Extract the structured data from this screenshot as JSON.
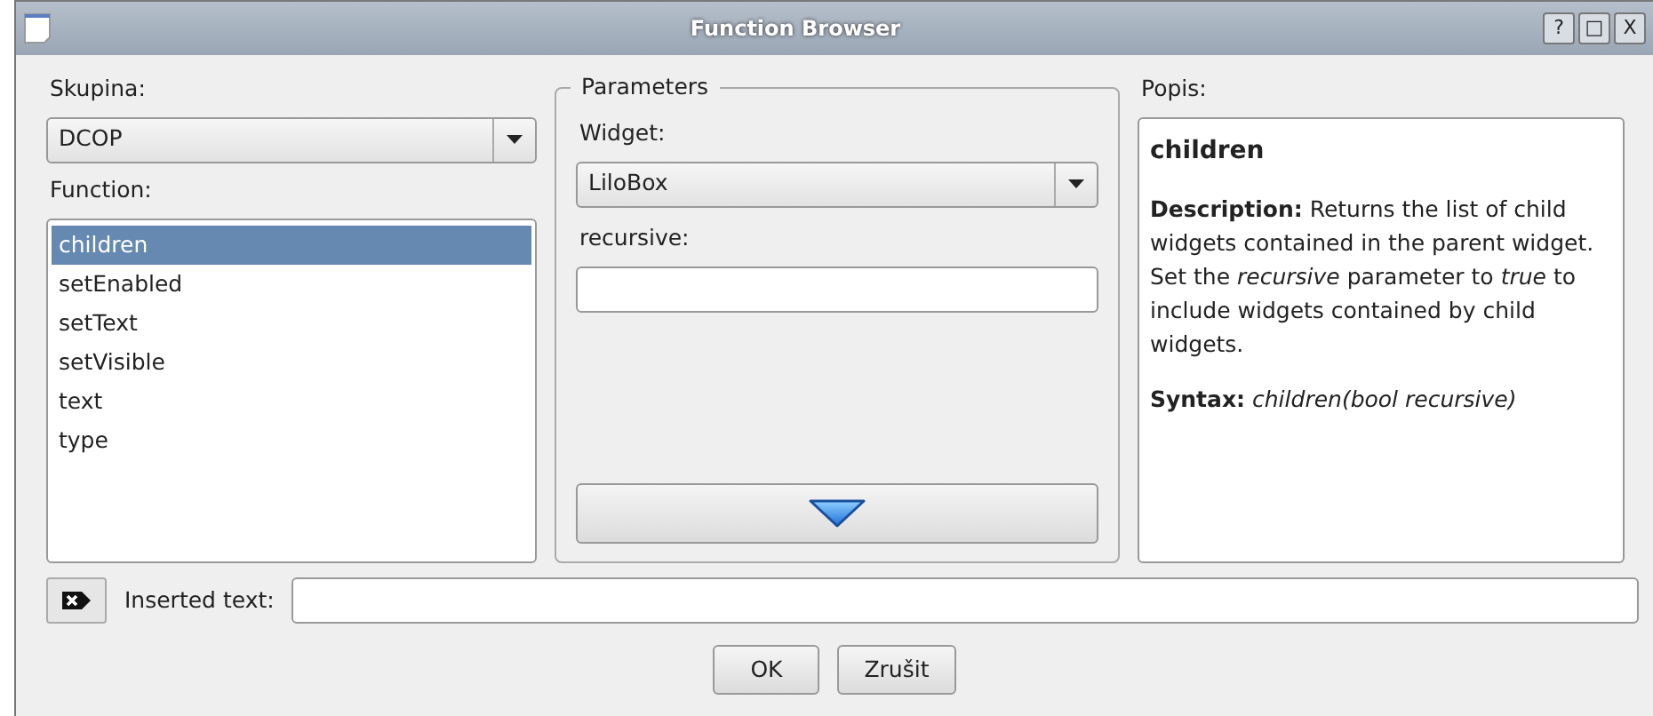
{
  "window": {
    "title": "Function Browser",
    "buttons": [
      "?",
      "□",
      "X"
    ]
  },
  "group": {
    "label": "Skupina:",
    "value": "DCOP"
  },
  "functions": {
    "label": "Function:",
    "items": [
      {
        "text": "children",
        "selected": true
      },
      {
        "text": "setEnabled",
        "selected": false
      },
      {
        "text": "setText",
        "selected": false
      },
      {
        "text": "setVisible",
        "selected": false
      },
      {
        "text": "text",
        "selected": false
      },
      {
        "text": "type",
        "selected": false
      }
    ]
  },
  "parameters": {
    "title": "Parameters",
    "widget_label": "Widget:",
    "widget_value": "LiloBox",
    "param_label": "recursive:"
  },
  "description": {
    "label": "Popis:",
    "heading": "children",
    "paragraphs": [
      "**Description:** Returns the list of child widgets contained in the parent widget. Set the *recursive* parameter to *true* to include widgets contained by child widgets.",
      "**Syntax:** *children(bool recursive)*"
    ]
  },
  "inserted": {
    "label": "Inserted text:"
  },
  "buttons": [
    "OK",
    "Zrušit"
  ]
}
